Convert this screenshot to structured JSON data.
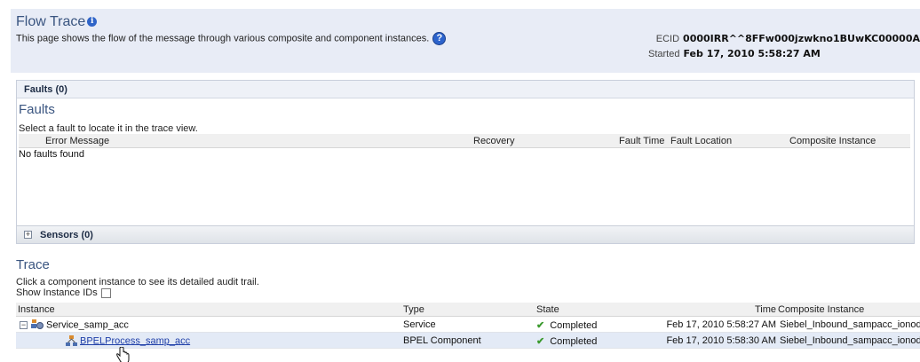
{
  "header": {
    "title": "Flow Trace",
    "description": "This page shows the flow of the message through various composite and component instances.",
    "ecid_label": "ECID",
    "ecid_value": "0000IRR^^8FFw000jzwkno1BUwKC00000A",
    "started_label": "Started",
    "started_value": "Feb 17, 2010 5:58:27 AM"
  },
  "faults": {
    "tab_label": "Faults (0)",
    "title": "Faults",
    "hint": "Select a fault to locate it in the trace view.",
    "columns": [
      "Error Message",
      "Recovery",
      "Fault Time",
      "Fault Location",
      "Composite Instance"
    ],
    "empty_text": "No faults found"
  },
  "sensors": {
    "label": "Sensors (0)"
  },
  "trace": {
    "title": "Trace",
    "hint": "Click a component instance to see its detailed audit trail.",
    "show_ids_label": "Show Instance IDs",
    "columns": [
      "Instance",
      "Type",
      "State",
      "Time",
      "Composite Instance"
    ],
    "rows": [
      {
        "instance": "Service_samp_acc",
        "type": "Service",
        "state": "Completed",
        "time": "Feb 17, 2010 5:58:27 AM",
        "composite": "Siebel_Inbound_sampacc_ionode"
      },
      {
        "instance": "BPELProcess_samp_acc",
        "type": "BPEL Component",
        "state": "Completed",
        "time": "Feb 17, 2010 5:58:30 AM",
        "composite": "Siebel_Inbound_sampacc_ionode"
      }
    ]
  },
  "colors": {
    "title": "#3a5580",
    "header_band": "#e8ecf6",
    "link": "#1f3fa8",
    "completed_check": "#3b9a2e"
  }
}
